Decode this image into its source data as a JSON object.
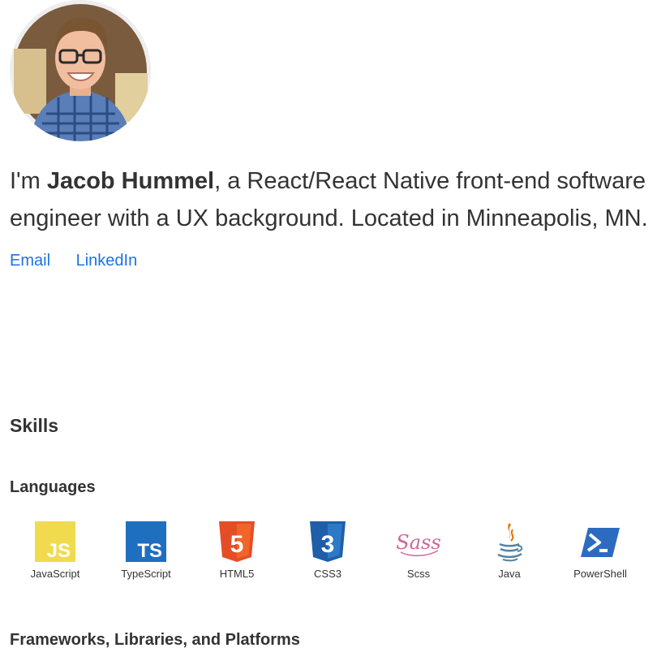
{
  "profile": {
    "avatar_alt": "Jacob Hummel",
    "intro_prefix": "I'm ",
    "name": "Jacob Hummel",
    "intro_suffix": ", a React/React Native front-end software engineer with a UX background. Located in Minneapolis, MN."
  },
  "links": {
    "email": "Email",
    "linkedin": "LinkedIn",
    "color": "#1a73e8"
  },
  "skills": {
    "heading": "Skills",
    "languages_heading": "Languages",
    "frameworks_heading": "Frameworks, Libraries, and Platforms",
    "languages": [
      {
        "label": "JavaScript",
        "icon": "javascript-icon",
        "color": "#f0db4f"
      },
      {
        "label": "TypeScript",
        "icon": "typescript-icon",
        "color": "#1f6fc1"
      },
      {
        "label": "HTML5",
        "icon": "html5-icon",
        "color": "#e44d26"
      },
      {
        "label": "CSS3",
        "icon": "css3-icon",
        "color": "#1f5ea8"
      },
      {
        "label": "Scss",
        "icon": "sass-icon",
        "color": "#cd6799"
      },
      {
        "label": "Java",
        "icon": "java-icon",
        "color": "#e76f00"
      },
      {
        "label": "PowerShell",
        "icon": "powershell-icon",
        "color": "#2d6bc1"
      }
    ],
    "badge_text": {
      "javascript": "JS",
      "typescript": "TS",
      "html5": "5",
      "css3": "3",
      "sass": "Sass"
    }
  }
}
